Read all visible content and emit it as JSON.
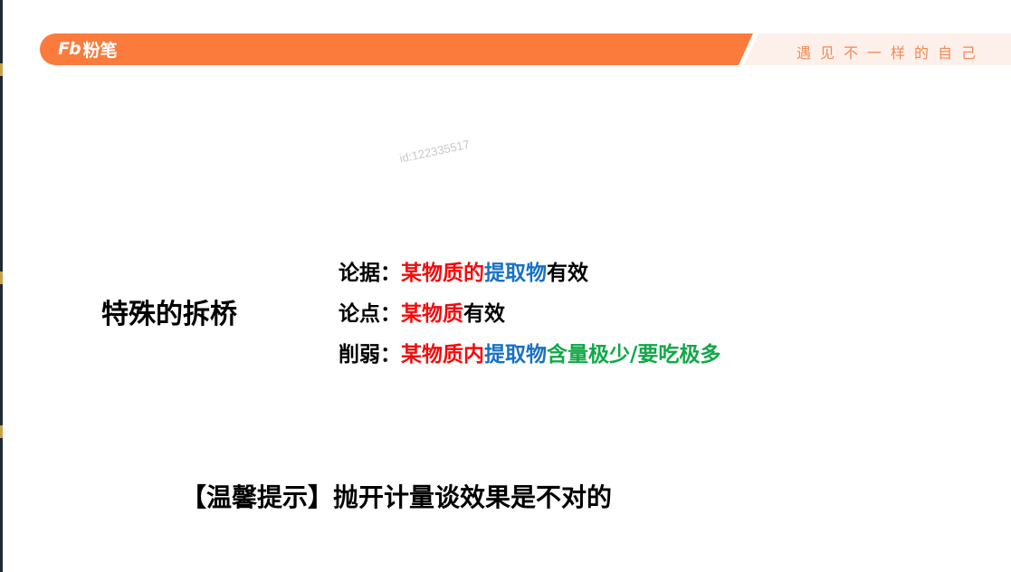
{
  "header": {
    "logo_mark": "Fb",
    "logo_text": "粉笔",
    "slogan": "遇见不一样的自己",
    "bar_color": "#fb7b3c",
    "slogan_color": "#f08a55"
  },
  "watermark": "id:122335517",
  "section_title": "特殊的拆桥",
  "lines": [
    {
      "label": "论据：",
      "segments": [
        {
          "text": "某物质的",
          "color": "#f20c0c"
        },
        {
          "text": "提取物",
          "color": "#1871c4"
        },
        {
          "text": "有效",
          "color": "#000000"
        }
      ]
    },
    {
      "label": "论点：",
      "segments": [
        {
          "text": "某物质",
          "color": "#f20c0c"
        },
        {
          "text": "有效",
          "color": "#000000"
        }
      ]
    },
    {
      "label": "削弱：",
      "segments": [
        {
          "text": "某物质内",
          "color": "#f20c0c"
        },
        {
          "text": "提取物",
          "color": "#1871c4"
        },
        {
          "text": "含量极少/要吃极多",
          "color": "#12a849"
        }
      ]
    }
  ],
  "tip": "【温馨提示】抛开计量谈效果是不对的"
}
